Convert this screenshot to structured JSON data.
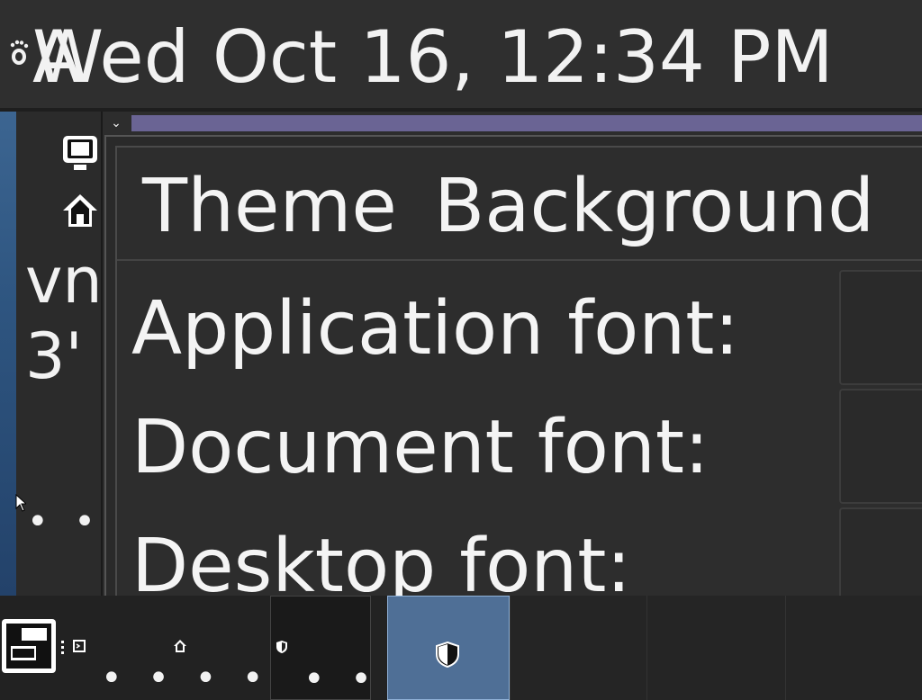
{
  "top_panel": {
    "activities_label": "A",
    "clock_text": "Wed Oct 16, 12:34 PM",
    "gnome_icon": "gnome-foot-icon"
  },
  "desktop": {
    "icons": [
      "computer-icon",
      "home-icon"
    ],
    "text_fragments": [
      "vn",
      "3'"
    ],
    "more_dots": "• • •"
  },
  "settings_window": {
    "tabs": [
      {
        "label": "Theme"
      },
      {
        "label": "Background"
      }
    ],
    "rows": [
      {
        "label": "Application font:"
      },
      {
        "label": "Document font:"
      },
      {
        "label": "Desktop font:"
      }
    ]
  },
  "taskbar": {
    "show_desktop_icon": "show-desktop-icon",
    "tasks": [
      {
        "icon": "terminal-icon",
        "dots": "• • • • • •"
      },
      {
        "icon": "home-icon",
        "dots": ""
      },
      {
        "icon": "shield-icon",
        "dots": "• • •"
      },
      {
        "icon": "shield-icon",
        "dots": ""
      }
    ]
  }
}
